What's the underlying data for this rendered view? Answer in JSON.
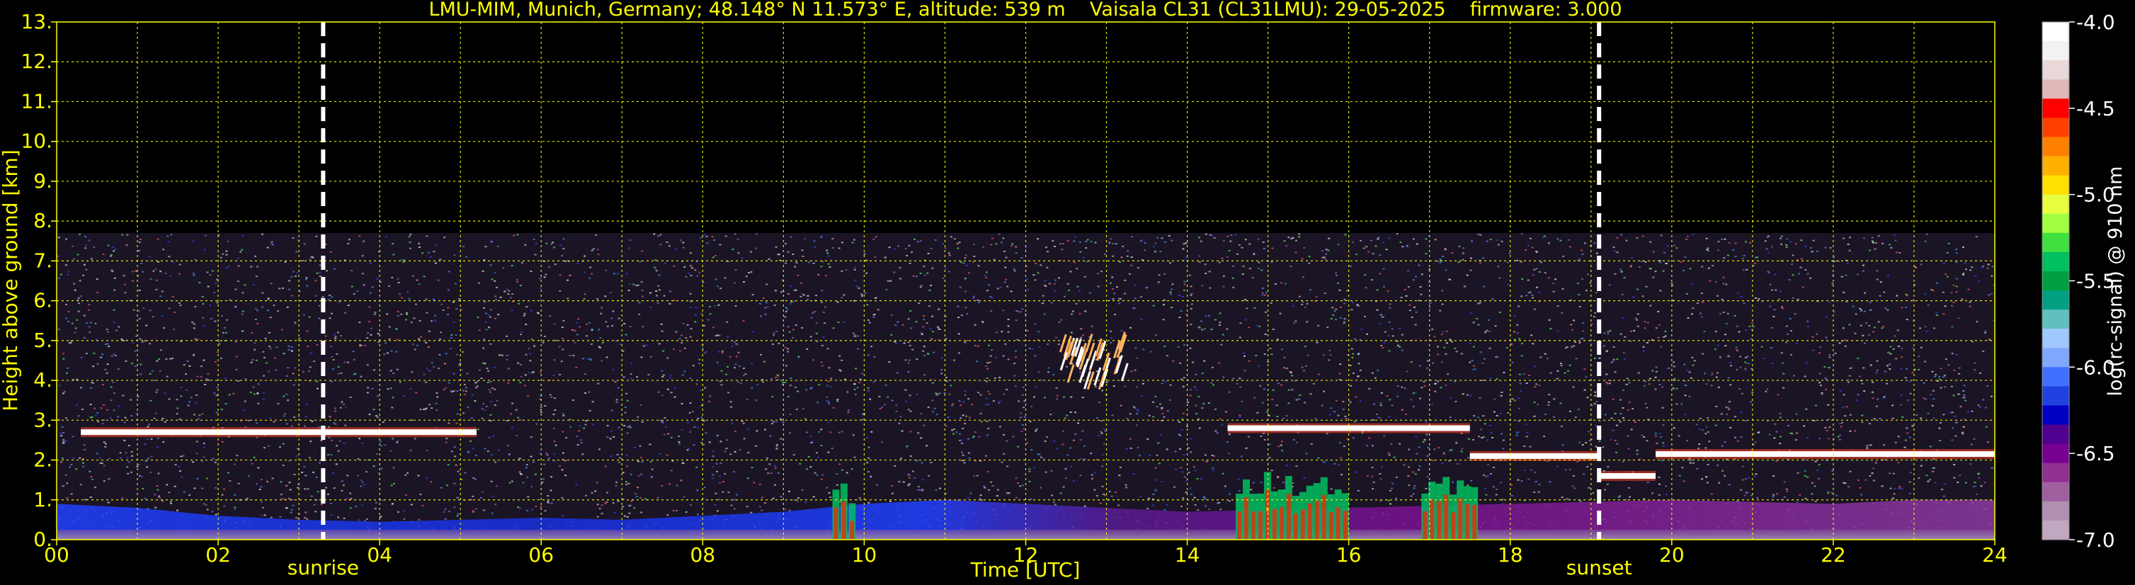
{
  "chart_data": {
    "type": "heatmap",
    "title": "LMU-MIM, Munich, Germany; 48.148° N 11.573° E, altitude: 539 m    Vaisala CL31 (CL31LMU): 29-05-2025    firmware: 3.000",
    "xlabel": "Time [UTC]",
    "ylabel": "Height above ground [km]",
    "xlim": [
      0,
      24
    ],
    "ylim": [
      0,
      13
    ],
    "x_ticks": [
      "00",
      "02",
      "04",
      "06",
      "08",
      "10",
      "12",
      "14",
      "16",
      "18",
      "20",
      "22",
      "24"
    ],
    "y_ticks": [
      "0.",
      "1.",
      "2.",
      "3.",
      "4.",
      "5.",
      "6.",
      "7.",
      "8.",
      "9.",
      "10.",
      "11.",
      "12.",
      "13."
    ],
    "grid": true,
    "max_signal_height_km": 7.7,
    "events": [
      {
        "label": "sunrise",
        "x": 3.3
      },
      {
        "label": "sunset",
        "x": 19.1
      }
    ],
    "features": [
      {
        "name": "cloud layer",
        "x_start": 0.3,
        "x_end": 5.2,
        "height_km": 2.7
      },
      {
        "name": "cloud layer",
        "x_start": 14.5,
        "x_end": 17.5,
        "height_km": 2.8
      },
      {
        "name": "cloud layer",
        "x_start": 17.5,
        "x_end": 19.1,
        "height_km": 2.1
      },
      {
        "name": "cloud layer",
        "x_start": 19.1,
        "x_end": 19.8,
        "height_km": 1.6
      },
      {
        "name": "cloud layer",
        "x_start": 19.8,
        "x_end": 24.0,
        "height_km": 2.15
      },
      {
        "name": "precipitation",
        "x_start": 9.6,
        "x_end": 9.9,
        "height_km": 1.6
      },
      {
        "name": "precipitation",
        "x_start": 14.6,
        "x_end": 16.0,
        "height_km": 1.8
      },
      {
        "name": "precipitation",
        "x_start": 16.9,
        "x_end": 17.6,
        "height_km": 1.7
      },
      {
        "name": "ice cloud",
        "x_start": 12.4,
        "x_end": 13.2,
        "height_km": 4.3
      }
    ],
    "colorbar": {
      "label": "log(rc-signal) @ 910 nm",
      "range": [
        -7.0,
        -4.0
      ],
      "ticks": [
        "-4.0",
        "-4.5",
        "-5.0",
        "-5.5",
        "-6.0",
        "-6.5",
        "-7.0"
      ],
      "colors": [
        "#ffffff",
        "#f2f2f2",
        "#e8d8d8",
        "#e0b8b8",
        "#ff0000",
        "#ff4000",
        "#ff8000",
        "#ffb000",
        "#ffe000",
        "#e8ff40",
        "#a0ff40",
        "#40e040",
        "#00c060",
        "#00a040",
        "#00a080",
        "#60c0c0",
        "#a0c8ff",
        "#80a8ff",
        "#4070ff",
        "#2040e0",
        "#0000c0",
        "#500090",
        "#780090",
        "#903090",
        "#a060a0",
        "#b090b0",
        "#c0a8c0"
      ]
    }
  }
}
